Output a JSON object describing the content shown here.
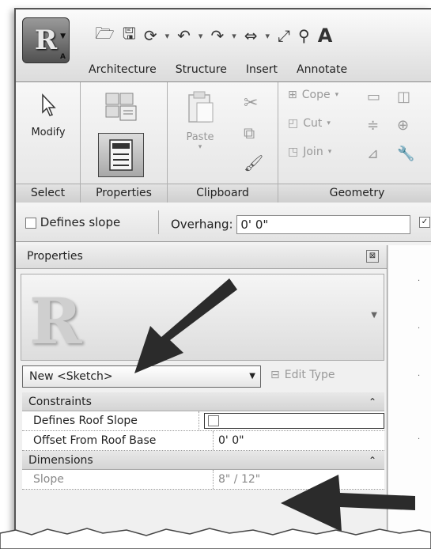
{
  "app": {
    "logo_letter": "R",
    "logo_sub": "A"
  },
  "ribbon_tabs": [
    "Architecture",
    "Structure",
    "Insert",
    "Annotate"
  ],
  "panels": {
    "select": {
      "tool_label": "Modify",
      "panel_label": "Select"
    },
    "properties": {
      "panel_label": "Properties"
    },
    "clipboard": {
      "paste_label": "Paste",
      "panel_label": "Clipboard"
    },
    "geometry": {
      "cope_label": "Cope",
      "cut_label": "Cut",
      "join_label": "Join",
      "panel_label": "Geometry"
    }
  },
  "options_bar": {
    "defines_slope_label": "Defines slope",
    "overhang_label": "Overhang:",
    "overhang_value": "0'  0\""
  },
  "properties_palette": {
    "title": "Properties",
    "close_glyph": "⊠",
    "type_selector": "New <Sketch>",
    "edit_type_label": "Edit Type",
    "groups": [
      {
        "name": "Constraints",
        "rows": [
          {
            "name": "Defines Roof Slope",
            "value": ""
          },
          {
            "name": "Offset From Roof Base",
            "value": "0'  0\""
          }
        ]
      },
      {
        "name": "Dimensions",
        "rows": [
          {
            "name": "Slope",
            "value": "8\" / 12\""
          }
        ]
      }
    ]
  },
  "colors": {
    "arrow": "#2b2b2b",
    "chrome": "#e4e4e4"
  }
}
